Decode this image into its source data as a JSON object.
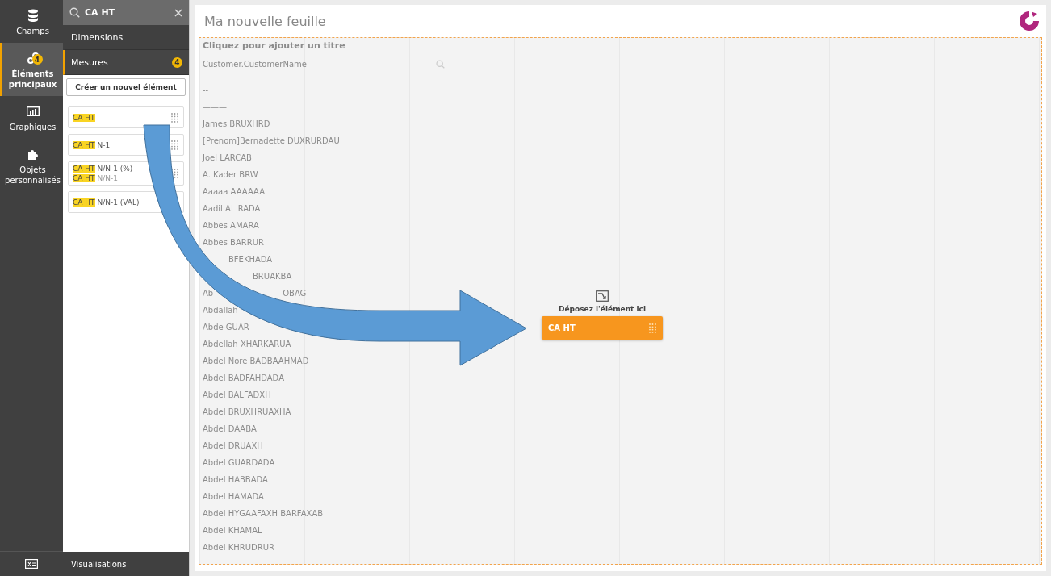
{
  "sidebar": {
    "items": [
      {
        "kind": "database",
        "label": "Champs",
        "selected": false
      },
      {
        "kind": "links",
        "label": "Éléments principaux",
        "selected": true,
        "badge": "4"
      },
      {
        "kind": "chart",
        "label": "Graphiques",
        "selected": false
      },
      {
        "kind": "puzzle",
        "label": "Objets personnalisés",
        "selected": false
      }
    ]
  },
  "panel": {
    "search": {
      "value": "CA HT"
    },
    "sections": [
      {
        "label": "Dimensions",
        "selected": false
      },
      {
        "label": "Mesures",
        "selected": true,
        "badge": "4"
      }
    ],
    "create_button": "Créer un nouvel élément",
    "items": [
      {
        "match": "CA HT"
      },
      {
        "match": "CA HT",
        "rest": "N-1"
      },
      {
        "match": "CA HT",
        "rest": "N/N-1 (%)",
        "sub": {
          "match": "CA HT",
          "rest": "N/N-1"
        }
      },
      {
        "match": "CA HT",
        "rest": "N/N-1 (VAL)"
      }
    ],
    "footer": "Visualisations"
  },
  "sheet": {
    "title": "Ma nouvelle feuille",
    "placeholder_title": "Cliquez pour ajouter un titre",
    "table": {
      "column": "Customer.CustomerName",
      "rows": [
        {
          "text": "--"
        },
        {
          "text": "———"
        },
        {
          "text": "James BRUXHRD"
        },
        {
          "text": "[Prenom]Bernadette DUXRURDAU"
        },
        {
          "text": "Joel LARCAB"
        },
        {
          "text": "A. Kader BRW"
        },
        {
          "text": "Aaaaa AAAAAA"
        },
        {
          "text": "Aadil AL RADA"
        },
        {
          "text": "Abbes AMARA"
        },
        {
          "text": "Abbes BARRUR"
        },
        {
          "after": "BFEKHADA"
        },
        {
          "after": "BRUAKBA"
        },
        {
          "text": "Ab",
          "after": "OBAG"
        },
        {
          "text": "Abdallah"
        },
        {
          "text": "Abde GUAR"
        },
        {
          "text": "Abdellah XHARKARUA"
        },
        {
          "text": "Abdel Nore BADBAAHMAD"
        },
        {
          "text": "Abdel BADFAHDADA"
        },
        {
          "text": "Abdel BALFADXH"
        },
        {
          "text": "Abdel BRUXHRUAXHA"
        },
        {
          "text": "Abdel DAABA"
        },
        {
          "text": "Abdel DRUAXH"
        },
        {
          "text": "Abdel GUARDADA"
        },
        {
          "text": "Abdel HABBADA"
        },
        {
          "text": "Abdel HAMADA"
        },
        {
          "text": "Abdel HYGAAFAXH BARFAXAB"
        },
        {
          "text": "Abdel KHAMAL"
        },
        {
          "text": "Abdel KHRUDRUR"
        }
      ]
    },
    "drop_hint": "Déposez l'élément ici",
    "dragged_item": "CA HT"
  }
}
